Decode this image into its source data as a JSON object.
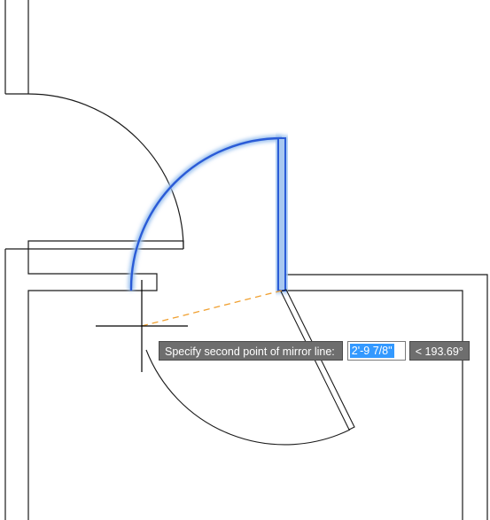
{
  "command_prompt": {
    "label": "Specify second point of mirror line:",
    "length_value": "2'-9 7/8\"",
    "angle_value": "< 193.69°"
  },
  "colors": {
    "linework": "#1a1a1a",
    "selection_highlight": "#2a5bd7",
    "selection_glow": "#9ec3ef",
    "mirror_line": "#f0a030",
    "prompt_bg": "#6e6e6e",
    "input_selection": "#3399ff"
  },
  "icons": {
    "cursor": "crosshair-icon"
  }
}
